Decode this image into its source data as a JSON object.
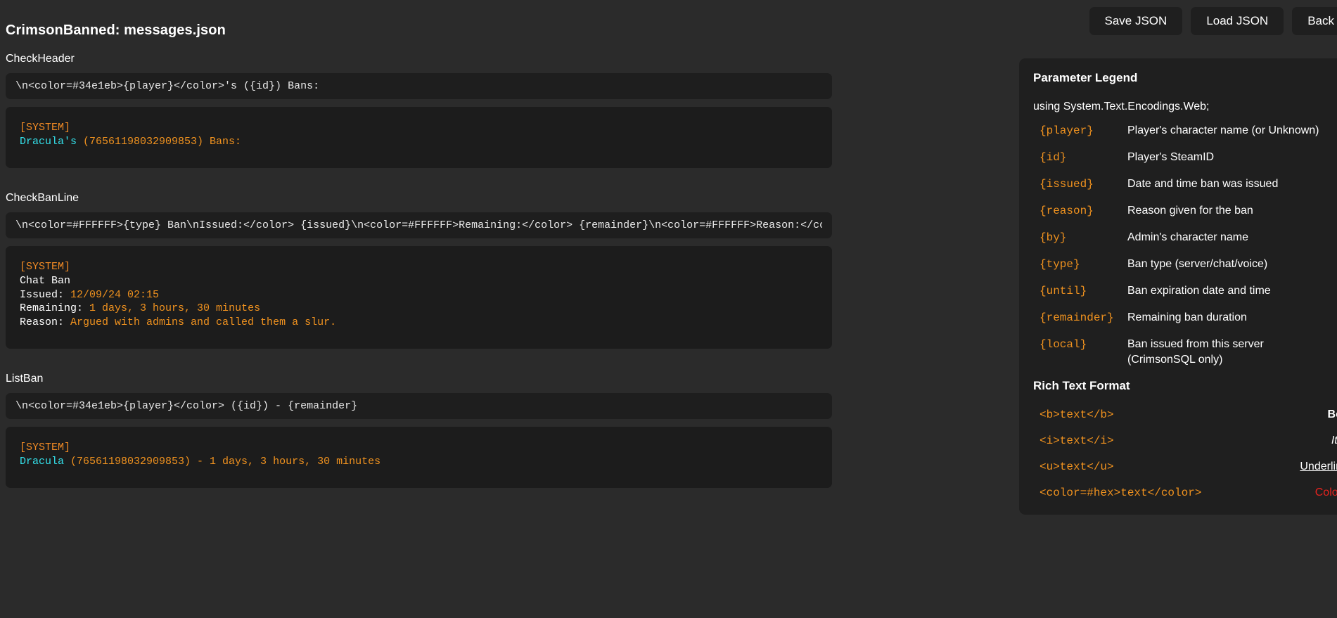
{
  "window": {
    "title": "CrimsonBanned: messages.json"
  },
  "toolbar": {
    "save_label": "Save JSON",
    "load_label": "Load JSON",
    "back_label": "Back"
  },
  "fields": [
    {
      "label": "CheckHeader",
      "value": "\\n<color=#34e1eb>{player}</color>'s ({id}) Bans:",
      "preview": {
        "system_tag": "[SYSTEM]",
        "lines": [
          {
            "cyan": "Dracula's",
            "orange": " (76561198032909853) Bans:"
          }
        ]
      }
    },
    {
      "label": "CheckBanLine",
      "value": "\\n<color=#FFFFFF>{type} Ban\\nIssued:</color> {issued}\\n<color=#FFFFFF>Remaining:</color> {remainder}\\n<color=#FFFFFF>Reason:</color> {reason}",
      "preview": {
        "system_tag": "[SYSTEM]",
        "lines": [
          {
            "white": "Chat Ban",
            "orange": ""
          },
          {
            "white": "Issued: ",
            "orange": "12/09/24 02:15"
          },
          {
            "white": "Remaining: ",
            "orange": "1 days, 3 hours, 30 minutes"
          },
          {
            "white": "Reason: ",
            "orange": "Argued with admins and called them a slur."
          }
        ]
      }
    },
    {
      "label": "ListBan",
      "value": "\\n<color=#34e1eb>{player}</color> ({id}) - {remainder}",
      "preview": {
        "system_tag": "[SYSTEM]",
        "lines": [
          {
            "cyan": "Dracula",
            "orange": " (76561198032909853) - 1 days, 3 hours, 30 minutes"
          }
        ]
      }
    }
  ],
  "legend": {
    "title": "Parameter Legend",
    "using_line": "using System.Text.Encodings.Web;",
    "params": [
      {
        "key": "{player}",
        "desc": "Player's character name (or Unknown)"
      },
      {
        "key": "{id}",
        "desc": "Player's SteamID"
      },
      {
        "key": "{issued}",
        "desc": "Date and time ban was issued"
      },
      {
        "key": "{reason}",
        "desc": "Reason given for the ban"
      },
      {
        "key": "{by}",
        "desc": "Admin's character name"
      },
      {
        "key": "{type}",
        "desc": "Ban type (server/chat/voice)"
      },
      {
        "key": "{until}",
        "desc": "Ban expiration date and time"
      },
      {
        "key": "{remainder}",
        "desc": "Remaining ban duration"
      },
      {
        "key": "{local}",
        "desc": "Ban issued from this server\n(CrimsonSQL only)"
      }
    ],
    "rich_text": {
      "title": "Rich Text Format",
      "rows": [
        {
          "code": "<b>text</b>",
          "sample": "Bold text",
          "style": "bold"
        },
        {
          "code": "<i>text</i>",
          "sample": "Italic text",
          "style": "italic"
        },
        {
          "code": "<u>text</u>",
          "sample": "Underlined text",
          "style": "underline"
        },
        {
          "code": "<color=#hex>text</color>",
          "sample": "Colored text",
          "style": "colored"
        }
      ]
    }
  },
  "colors": {
    "background": "#2b2b2b",
    "panel": "#1f1f1f",
    "input": "#1e1e1e",
    "preview": "#1c1c1c",
    "accent_orange": "#f0921f",
    "accent_cyan": "#34e1eb",
    "accent_red": "#e8231f",
    "text": "#ffffff"
  }
}
